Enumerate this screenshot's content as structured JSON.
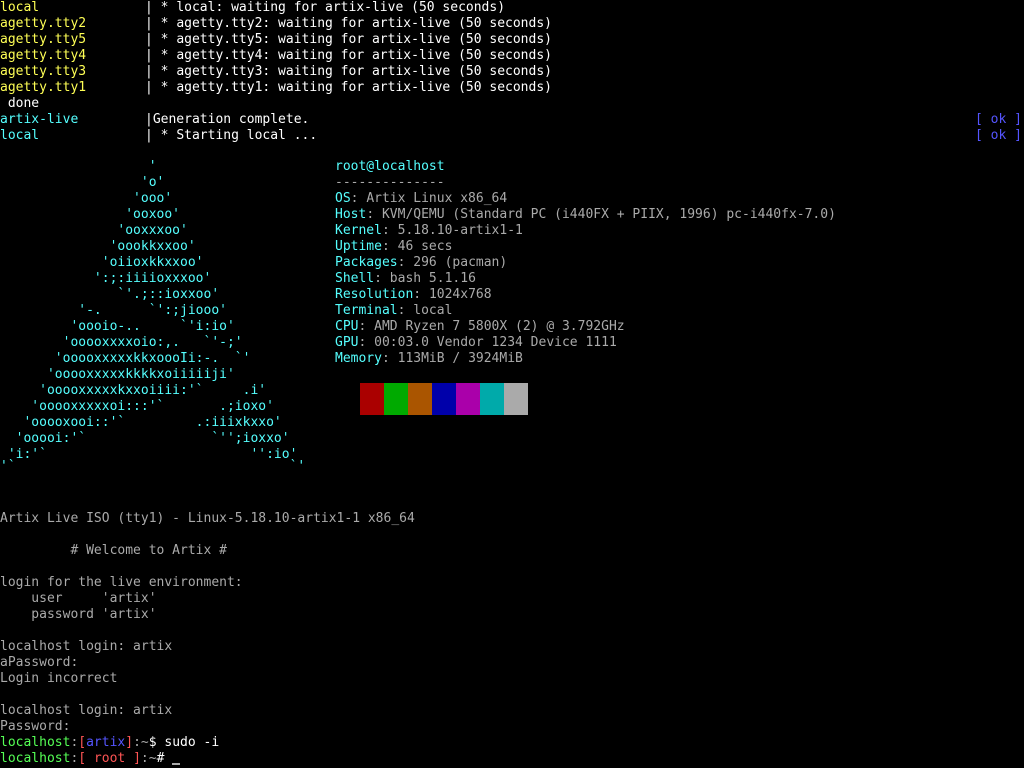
{
  "boot_log": [
    {
      "service": "local",
      "sep": "| * ",
      "msg": "local: waiting for artix-live (50 seconds)"
    },
    {
      "service": "agetty.tty2",
      "sep": "| * ",
      "msg": "agetty.tty2: waiting for artix-live (50 seconds)"
    },
    {
      "service": "agetty.tty5",
      "sep": "| * ",
      "msg": "agetty.tty5: waiting for artix-live (50 seconds)"
    },
    {
      "service": "agetty.tty4",
      "sep": "| * ",
      "msg": "agetty.tty4: waiting for artix-live (50 seconds)"
    },
    {
      "service": "agetty.tty3",
      "sep": "| * ",
      "msg": "agetty.tty3: waiting for artix-live (50 seconds)"
    },
    {
      "service": "agetty.tty1",
      "sep": "| * ",
      "msg": "agetty.tty1: waiting for artix-live (50 seconds)"
    }
  ],
  "done_text": " done",
  "artix_live_line": {
    "service": "artix-live",
    "sep": "|",
    "msg": "Generation complete.",
    "status": "[ ok ]"
  },
  "local_line": {
    "service": "local",
    "sep": "| * ",
    "msg": "Starting local ...",
    "status": "[ ok ]"
  },
  "ascii_logo": [
    "                   '",
    "                  'o'",
    "                 'ooo'",
    "                'ooxoo'",
    "               'ooxxxoo'",
    "              'oookkxxoo'",
    "             'oiioxkkxxoo'",
    "            ':;:iiiioxxxoo'",
    "               `'.;::ioxxoo'",
    "          '-.      `':;jiooo'",
    "         'oooio-..     `'i:io'",
    "        'ooooxxxxoio:,.   `'-;'",
    "       'ooooxxxxxkkxoooIi:-.  `'",
    "      'ooooxxxxxkkkkxoiiiiiji'",
    "     'ooooxxxxxkxxoiiii:'`     .i'",
    "    'ooooxxxxxoi:::'`       .;ioxo'",
    "   'ooooxooi::'`         .:iiixkxxo'",
    "  'ooooi:'`                `'';ioxxo'",
    " 'i:'`                          '':io'",
    "'`                                   `'"
  ],
  "neofetch": {
    "user_host": "root@localhost",
    "divider": "--------------",
    "fields": [
      {
        "key": "OS",
        "value": "Artix Linux x86_64"
      },
      {
        "key": "Host",
        "value": "KVM/QEMU (Standard PC (i440FX + PIIX, 1996) pc-i440fx-7.0)"
      },
      {
        "key": "Kernel",
        "value": "5.18.10-artix1-1"
      },
      {
        "key": "Uptime",
        "value": "46 secs"
      },
      {
        "key": "Packages",
        "value": "296 (pacman)"
      },
      {
        "key": "Shell",
        "value": "bash 5.1.16"
      },
      {
        "key": "Resolution",
        "value": "1024x768"
      },
      {
        "key": "Terminal",
        "value": "local"
      },
      {
        "key": "CPU",
        "value": "AMD Ryzen 7 5800X (2) @ 3.792GHz"
      },
      {
        "key": "GPU",
        "value": "00:03.0 Vendor 1234 Device 1111"
      },
      {
        "key": "Memory",
        "value": "113MiB / 3924MiB"
      }
    ],
    "palette": [
      "#aa0000",
      "#00aa00",
      "#aa5500",
      "#0000aa",
      "#aa00aa",
      "#00aaaa",
      "#aaaaaa"
    ]
  },
  "console": {
    "issue_line": "Artix Live ISO (tty1) - Linux-5.18.10-artix1-1 x86_64",
    "welcome": "         # Welcome to Artix #",
    "login_for": "login for the live environment:",
    "user_line": "    user     'artix'",
    "password_line": "    password 'artix'",
    "login1": "localhost login: artix",
    "password1": "aPassword:",
    "incorrect": "Login incorrect",
    "login2": "localhost login: artix",
    "password2": "Password:"
  },
  "prompt1": {
    "host": "localhost",
    "colon": ":",
    "lb": "[",
    "user": "artix",
    "rb": "]",
    "path": ":~",
    "sym": "$ ",
    "command": "sudo -i"
  },
  "prompt2": {
    "host": "localhost",
    "colon": ":",
    "lb": "[",
    "user": " root ",
    "rb": "]",
    "path": ":~",
    "sym": "# "
  }
}
